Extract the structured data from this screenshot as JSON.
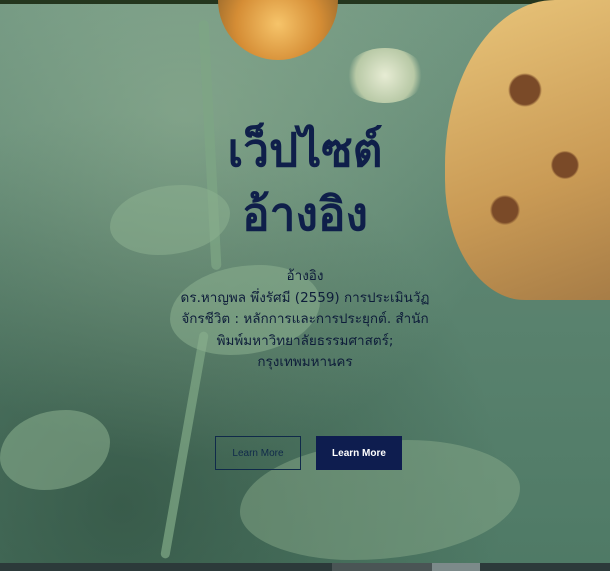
{
  "hero": {
    "title_line1": "เว็ปไซต์",
    "title_line2": "อ้างอิง",
    "reference": [
      "อ้างอิง",
      "ดร.หาญพล พึ่งรัศมี (2559) การประเมินวัฏ",
      "จักรชีวิต : หลักการและการประยุกต์. สำนัก",
      "พิมพ์มหาวิทยาลัยธรรมศาสตร์;",
      "กรุงเทพมหานคร"
    ],
    "button_outline_label": "Learn More",
    "button_solid_label": "Learn More"
  },
  "colors": {
    "title": "#0f1f4a",
    "button_solid_bg": "#0e1d4f",
    "background": "#5f8772"
  }
}
